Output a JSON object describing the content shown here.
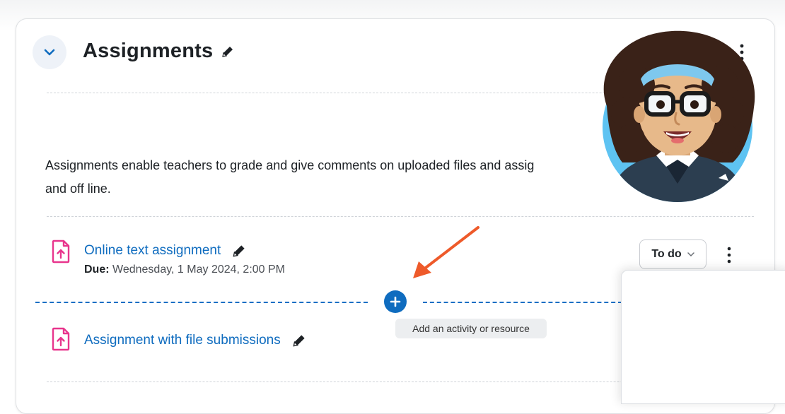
{
  "section": {
    "title": "Assignments",
    "summary_line1": "Assignments enable teachers to grade and give comments on uploaded files and assig",
    "summary_line2": "and off line."
  },
  "activities": [
    {
      "name": "Online text assignment",
      "due_label": "Due:",
      "due_value": "Wednesday, 1 May 2024, 2:00 PM",
      "status_button": "To do"
    },
    {
      "name": "Assignment with file submissions"
    }
  ],
  "add_activity": {
    "tooltip": "Add an activity or resource"
  },
  "colors": {
    "link": "#0f6cbf",
    "activity_icon": "#e8358d",
    "add_button": "#0f6cbf",
    "annotation_arrow": "#ee5a2a"
  },
  "icons": {
    "collapse": "chevron-down-icon",
    "edit": "pencil-icon",
    "menu": "kebab-menu-icon",
    "activity": "file-upload-icon",
    "add": "plus-icon"
  }
}
